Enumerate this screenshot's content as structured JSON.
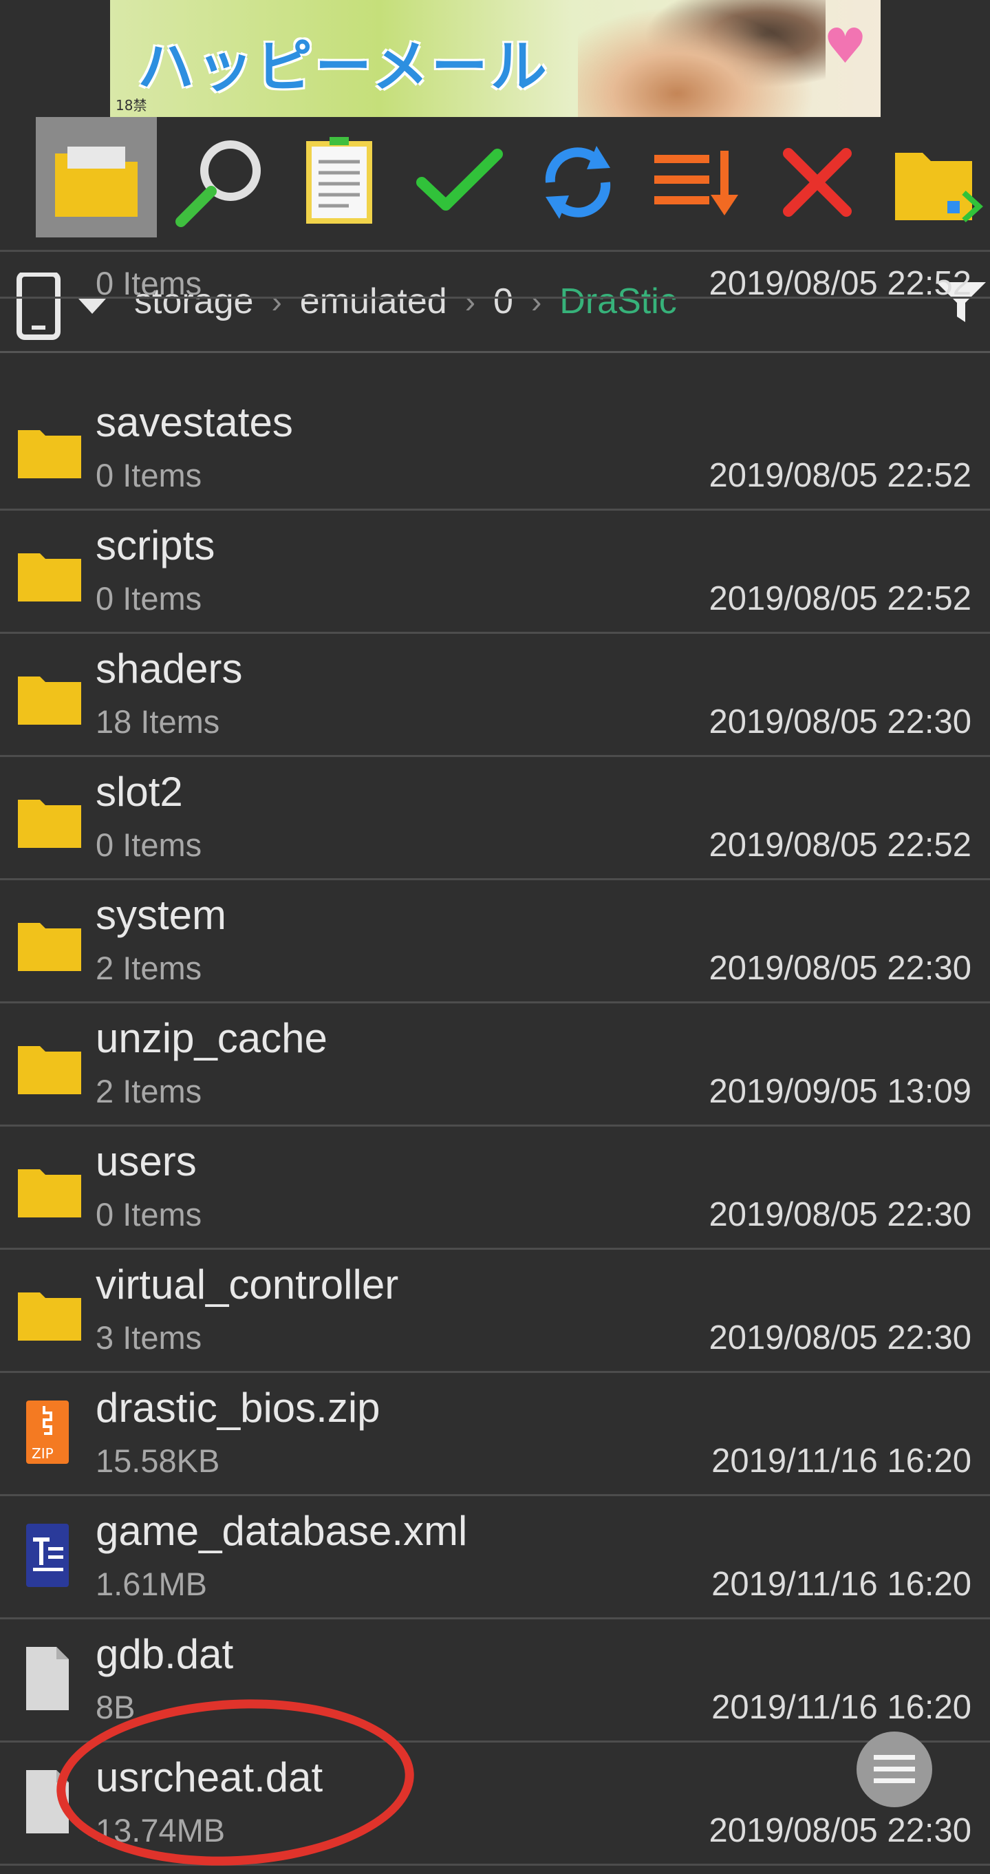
{
  "ad_banner": {
    "logo_text": "ハッピーメール",
    "age_label": "18禁"
  },
  "toolbar": {
    "items": [
      {
        "icon": "folder-icon",
        "active": true
      },
      {
        "icon": "search-icon"
      },
      {
        "icon": "notepad-icon"
      },
      {
        "icon": "checkmark-icon"
      },
      {
        "icon": "refresh-icon"
      },
      {
        "icon": "sort-icon"
      },
      {
        "icon": "close-icon"
      },
      {
        "icon": "move-folder-icon"
      }
    ]
  },
  "pathbar": {
    "device_icon": "phone-icon",
    "crumbs": [
      "storage",
      "emulated",
      "0",
      "DraStic"
    ],
    "separator": ">"
  },
  "files": [
    {
      "name": "",
      "sub": "0 Items",
      "date": "2019/08/05 22:52",
      "type": "folder",
      "partial": true
    },
    {
      "name": "savestates",
      "sub": "0 Items",
      "date": "2019/08/05 22:52",
      "type": "folder"
    },
    {
      "name": "scripts",
      "sub": "0 Items",
      "date": "2019/08/05 22:52",
      "type": "folder"
    },
    {
      "name": "shaders",
      "sub": "18 Items",
      "date": "2019/08/05 22:30",
      "type": "folder"
    },
    {
      "name": "slot2",
      "sub": "0 Items",
      "date": "2019/08/05 22:52",
      "type": "folder"
    },
    {
      "name": "system",
      "sub": "2 Items",
      "date": "2019/08/05 22:30",
      "type": "folder"
    },
    {
      "name": "unzip_cache",
      "sub": "2 Items",
      "date": "2019/09/05 13:09",
      "type": "folder"
    },
    {
      "name": "users",
      "sub": "0 Items",
      "date": "2019/08/05 22:30",
      "type": "folder"
    },
    {
      "name": "virtual_controller",
      "sub": "3 Items",
      "date": "2019/08/05 22:30",
      "type": "folder"
    },
    {
      "name": "drastic_bios.zip",
      "sub": "15.58KB",
      "date": "2019/11/16 16:20",
      "type": "zip"
    },
    {
      "name": "game_database.xml",
      "sub": "1.61MB",
      "date": "2019/11/16 16:20",
      "type": "text"
    },
    {
      "name": "gdb.dat",
      "sub": "8B",
      "date": "2019/11/16 16:20",
      "type": "file"
    },
    {
      "name": "usrcheat.dat",
      "sub": "13.74MB",
      "date": "2019/08/05 22:30",
      "type": "file"
    }
  ],
  "colors": {
    "background": "#2f2f2f",
    "folder": "#f1c21b",
    "accent_green": "#37b27a",
    "annotation_red": "#e0332b"
  },
  "fab": {
    "icon": "menu-icon"
  }
}
